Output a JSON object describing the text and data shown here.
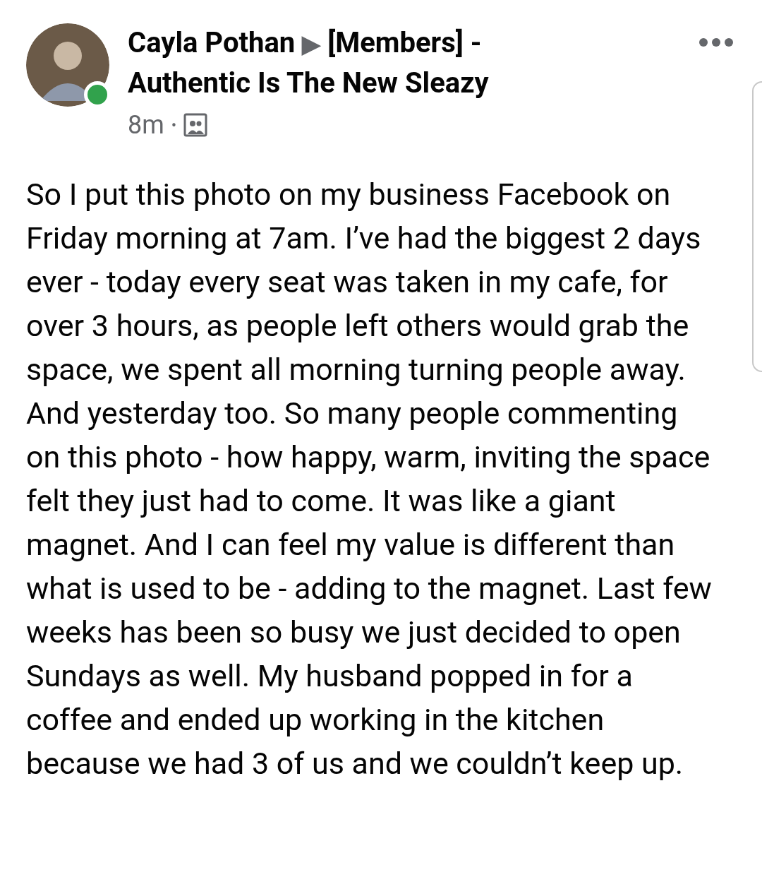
{
  "post": {
    "author": "Cayla Pothan",
    "separator": "▶",
    "group": "[Members] - Authentic Is The New Sleazy",
    "online": true,
    "time": "8m",
    "dot": "•",
    "body": "So I put this photo on my business Facebook on Friday morning at 7am. I’ve had the biggest 2 days ever - today every seat was taken in my cafe, for over 3 hours, as people left others would grab the space, we spent all morning turning people away. And yesterday too. So many people commenting on this photo - how happy, warm, inviting the space felt they just had to come. It was like a giant magnet. And I can feel my value is different than what is used to be - adding to the magnet. Last few weeks has been so busy we just decided to open Sundays as well. My husband popped in for a coffee and ended up working in the kitchen because we had 3 of us and we couldn’t keep up."
  }
}
